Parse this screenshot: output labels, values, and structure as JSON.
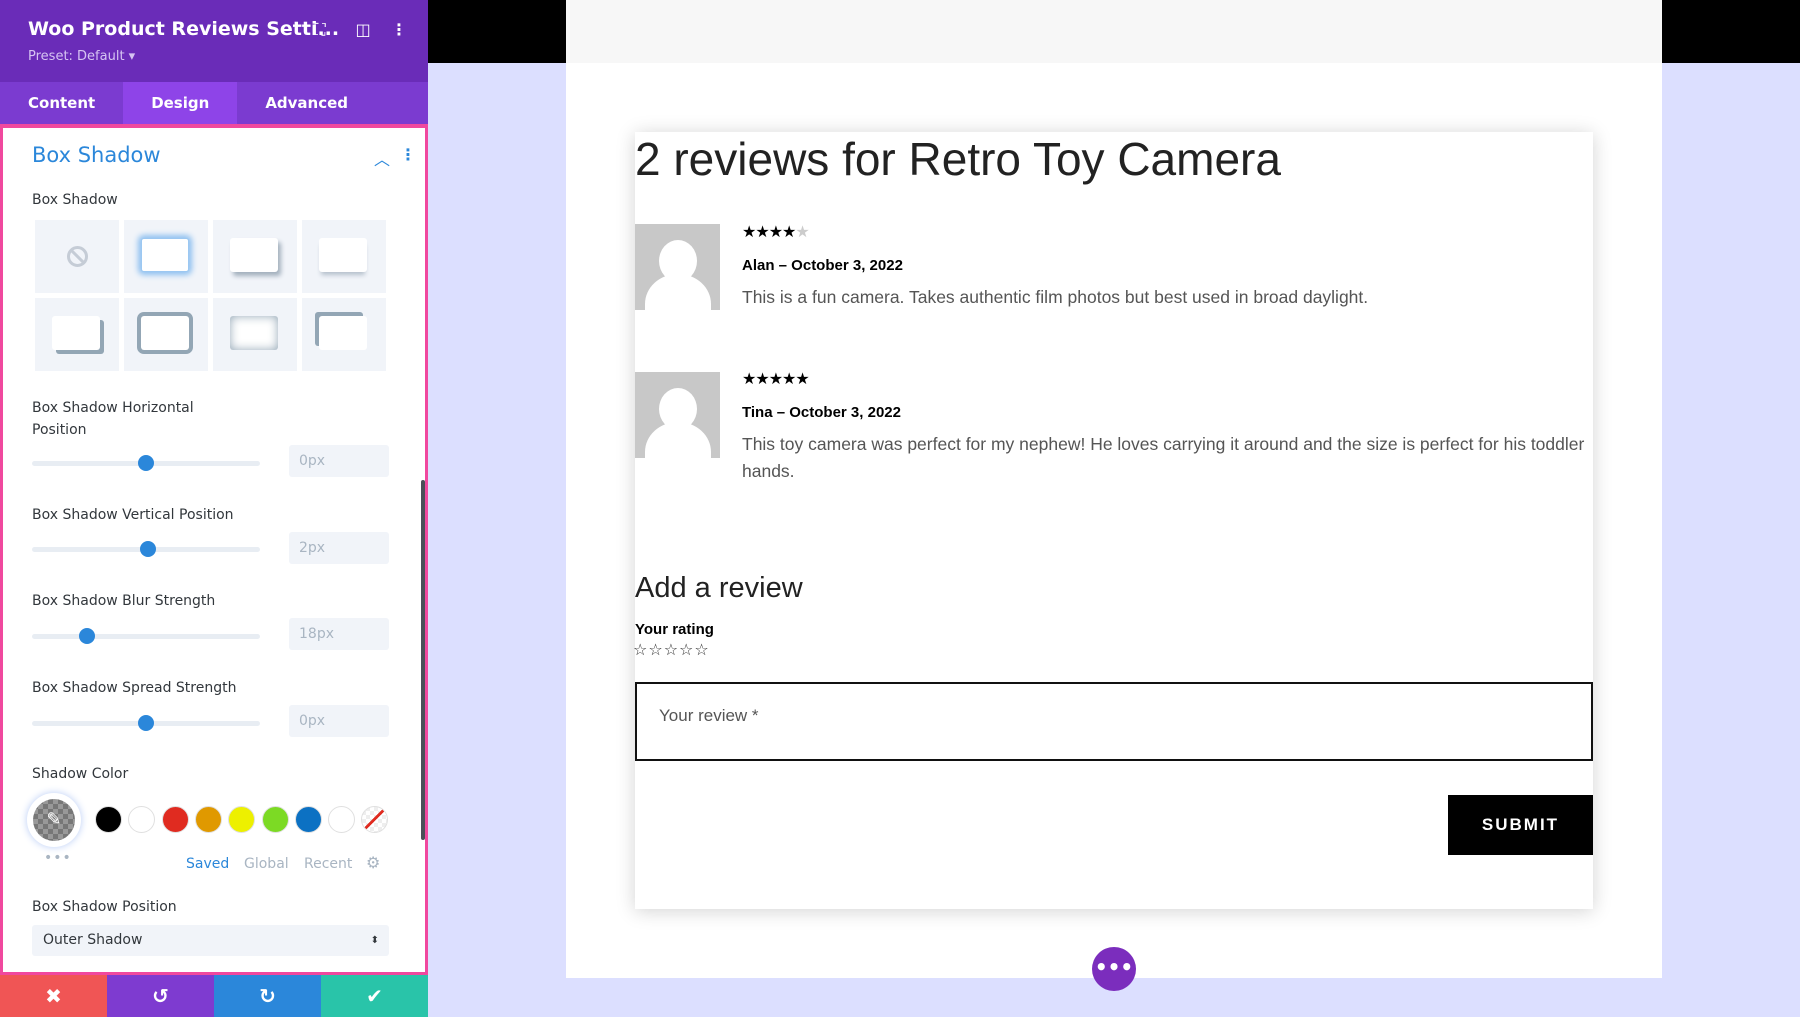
{
  "settings": {
    "title": "Woo Product Reviews Setti...",
    "preset": "Preset: Default ▾",
    "tabs": [
      {
        "label": "Content"
      },
      {
        "label": "Design"
      },
      {
        "label": "Advanced"
      }
    ],
    "active_tab": "Design",
    "section": "Box Shadow",
    "box_shadow_label": "Box Shadow",
    "sliders": [
      {
        "label": "Box Shadow Horizontal Position",
        "value": "0px",
        "position_pct": 50
      },
      {
        "label": "Box Shadow Vertical Position",
        "value": "2px",
        "position_pct": 51
      },
      {
        "label": "Box Shadow Blur Strength",
        "value": "18px",
        "position_pct": 24
      },
      {
        "label": "Box Shadow Spread Strength",
        "value": "0px",
        "position_pct": 50
      }
    ],
    "shadow_color_label": "Shadow Color",
    "swatches": [
      "#000000",
      "#ffffff",
      "#e02b20",
      "#e09900",
      "#edf000",
      "#7cda24",
      "#0c71c3",
      "#ffffff",
      "none"
    ],
    "color_tabs": {
      "saved": "Saved",
      "global": "Global",
      "recent": "Recent"
    },
    "position_label": "Box Shadow Position",
    "position_value": "Outer Shadow",
    "colors": {
      "header": "#6a2cb8",
      "accent": "#2b87da",
      "highlight": "#f0489e",
      "cancel": "#f05555",
      "undo": "#7e3bd0",
      "redo": "#2b87da",
      "save": "#29c4a9"
    }
  },
  "preview": {
    "heading": "2 reviews for Retro Toy Camera",
    "reviews": [
      {
        "rating": 4,
        "stars": "★★★★",
        "empty": "★",
        "author": "Alan – October 3, 2022",
        "text": "This is a fun camera. Takes authentic film photos but best used in broad daylight."
      },
      {
        "rating": 5,
        "stars": "★★★★★",
        "empty": "",
        "author": "Tina – October 3, 2022",
        "text": "This toy camera was perfect for my nephew! He loves carrying it around and the size is perfect for his toddler hands."
      }
    ],
    "add_review": "Add a review",
    "your_rating": "Your rating",
    "rating_stars": "☆☆☆☆☆",
    "review_placeholder": "Your review *",
    "submit": "SUBMIT"
  }
}
